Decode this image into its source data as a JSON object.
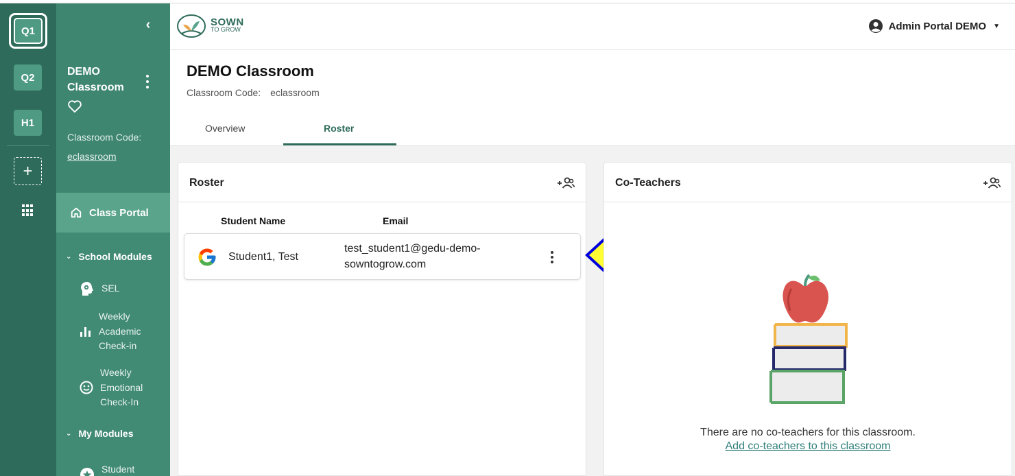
{
  "rail": {
    "items": [
      {
        "label": "Q1",
        "active": true
      },
      {
        "label": "Q2",
        "active": false
      },
      {
        "label": "H1",
        "active": false
      }
    ],
    "add_label": "+"
  },
  "sidebar": {
    "classroom_name": "DEMO Classroom",
    "code_label": "Classroom Code:",
    "code_value": "eclassroom",
    "portal_label": "Class Portal",
    "school_modules_label": "School Modules",
    "school_modules": [
      {
        "label": "SEL",
        "icon": "head-gear-icon"
      },
      {
        "label": "Weekly Academic Check-in",
        "icon": "bar-chart-icon"
      },
      {
        "label": "Weekly Emotional Check-In",
        "icon": "smiley-icon"
      }
    ],
    "my_modules_label": "My Modules",
    "my_modules": [
      {
        "label": "Student",
        "icon": "star-icon"
      }
    ]
  },
  "header": {
    "logo_line1": "SOWN",
    "logo_line2": "TO GROW",
    "user_name": "Admin Portal DEMO"
  },
  "classroom": {
    "title": "DEMO Classroom",
    "code_label": "Classroom Code:",
    "code_value": "eclassroom"
  },
  "tabs": [
    {
      "label": "Overview",
      "active": false
    },
    {
      "label": "Roster",
      "active": true
    }
  ],
  "roster": {
    "title": "Roster",
    "columns": [
      "Student Name",
      "Email"
    ],
    "rows": [
      {
        "name": "Student1, Test",
        "email": "test_student1@gedu-demo-sowntogrow.com",
        "email_line1": "test_student1@gedu-demo-",
        "email_line2": "sowntogrow.com",
        "provider_icon": "google-icon"
      }
    ]
  },
  "coteachers": {
    "title": "Co-Teachers",
    "empty_message": "There are no co-teachers for this classroom.",
    "add_link": "Add co-teachers to this classroom"
  },
  "colors": {
    "rail": "#2e6b5a",
    "sidebar": "#418a73",
    "accent": "#2e6b5a",
    "annotation_arrow_fill": "#ffff33",
    "annotation_arrow_stroke": "#0000dd"
  }
}
